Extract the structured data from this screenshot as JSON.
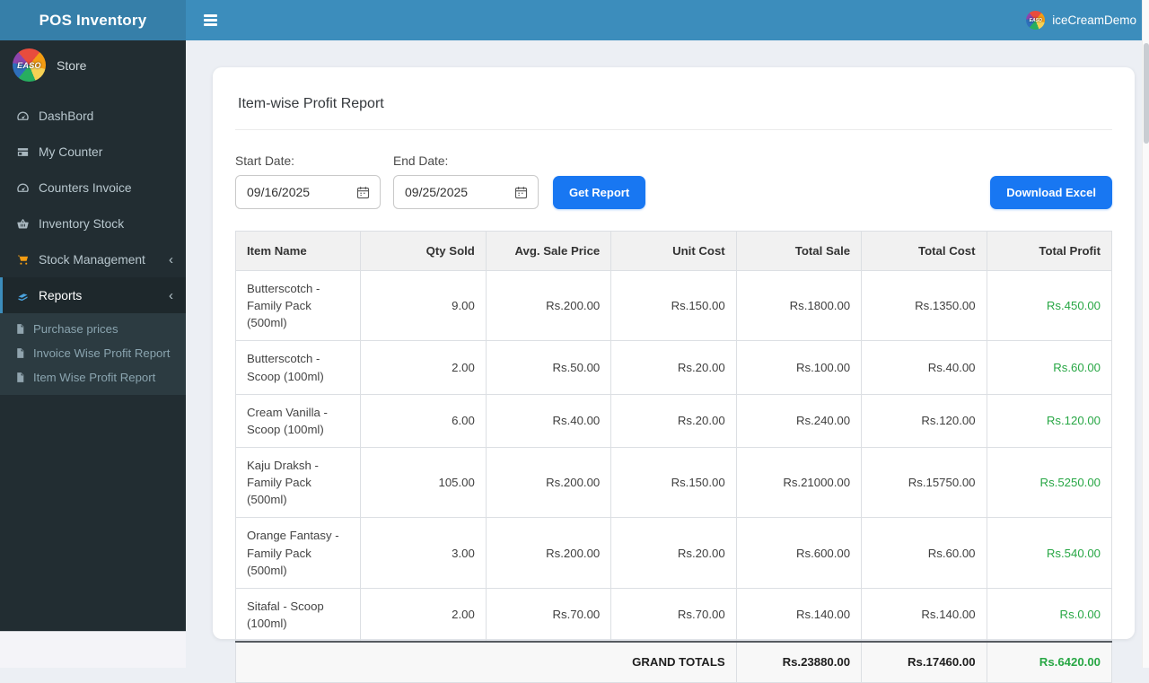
{
  "app": {
    "title": "POS Inventory",
    "logo_text": "EASO",
    "user_name": "iceCreamDemo",
    "store_label": "Store"
  },
  "sidebar": {
    "items": [
      {
        "label": "DashBord",
        "icon": "dashboard",
        "chevron": false,
        "active": false
      },
      {
        "label": "My Counter",
        "icon": "counter",
        "chevron": false,
        "active": false
      },
      {
        "label": "Counters Invoice",
        "icon": "dashboard",
        "chevron": false,
        "active": false
      },
      {
        "label": "Inventory Stock",
        "icon": "basket",
        "chevron": false,
        "active": false
      },
      {
        "label": "Stock Management",
        "icon": "cart",
        "chevron": true,
        "active": false
      },
      {
        "label": "Reports",
        "icon": "report",
        "chevron": true,
        "active": true
      }
    ],
    "submenu": [
      {
        "label": "Purchase prices",
        "icon": "file"
      },
      {
        "label": "Invoice Wise Profit Report",
        "icon": "file"
      },
      {
        "label": "Item Wise Profit Report",
        "icon": "file"
      }
    ]
  },
  "report": {
    "title": "Item-wise Profit Report",
    "filters": {
      "start_label": "Start Date:",
      "start_value": "09/16/2025",
      "end_label": "End Date:",
      "end_value": "09/25/2025",
      "get_report_label": "Get Report",
      "download_label": "Download Excel"
    },
    "table": {
      "headers": [
        "Item Name",
        "Qty Sold",
        "Avg. Sale Price",
        "Unit Cost",
        "Total Sale",
        "Total Cost",
        "Total Profit"
      ],
      "rows": [
        [
          "Butterscotch - Family Pack (500ml)",
          "9.00",
          "Rs.200.00",
          "Rs.150.00",
          "Rs.1800.00",
          "Rs.1350.00",
          "Rs.450.00"
        ],
        [
          "Butterscotch - Scoop (100ml)",
          "2.00",
          "Rs.50.00",
          "Rs.20.00",
          "Rs.100.00",
          "Rs.40.00",
          "Rs.60.00"
        ],
        [
          "Cream Vanilla - Scoop (100ml)",
          "6.00",
          "Rs.40.00",
          "Rs.20.00",
          "Rs.240.00",
          "Rs.120.00",
          "Rs.120.00"
        ],
        [
          "Kaju Draksh - Family Pack (500ml)",
          "105.00",
          "Rs.200.00",
          "Rs.150.00",
          "Rs.21000.00",
          "Rs.15750.00",
          "Rs.5250.00"
        ],
        [
          "Orange Fantasy - Family Pack (500ml)",
          "3.00",
          "Rs.200.00",
          "Rs.20.00",
          "Rs.600.00",
          "Rs.60.00",
          "Rs.540.00"
        ],
        [
          "Sitafal - Scoop (100ml)",
          "2.00",
          "Rs.70.00",
          "Rs.70.00",
          "Rs.140.00",
          "Rs.140.00",
          "Rs.0.00"
        ]
      ],
      "totals": {
        "label": "GRAND TOTALS",
        "total_sale": "Rs.23880.00",
        "total_cost": "Rs.17460.00",
        "total_profit": "Rs.6420.00"
      }
    }
  },
  "colors": {
    "navbar_blue": "#3c8dbc",
    "logo_blue": "#367fa9",
    "sidebar_dark": "#222d32",
    "submenu_dark": "#2c3b41",
    "button_blue": "#1877f2",
    "profit_green": "#28a745"
  }
}
